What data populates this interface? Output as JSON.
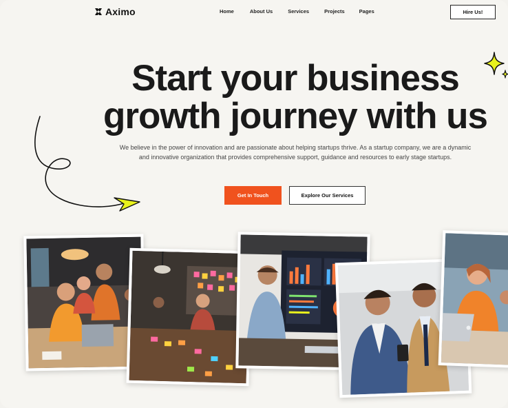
{
  "brand": {
    "name": "Aximo"
  },
  "nav": {
    "items": [
      "Home",
      "About Us",
      "Services",
      "Projects",
      "Pages"
    ]
  },
  "header": {
    "cta_label": "Hire Us!"
  },
  "hero": {
    "title_line1": "Start your business",
    "title_line2": "growth journey with us",
    "subtitle_line1": "We believe in the power of innovation and are passionate about helping startups thrive. As a startup company, we are a dynamic",
    "subtitle_line2": "and innovative organization that provides comprehensive support, guidance and resources to early stage startups.",
    "primary_cta": "Get In Touch",
    "secondary_cta": "Explore Our Services"
  },
  "colors": {
    "accent": "#f0521e",
    "highlight": "#e9f21d",
    "text": "#1a1a1a",
    "background": "#f6f5f1"
  },
  "icons": [
    "aximo-logo-icon",
    "sparkle-star-icon",
    "curly-arrow-icon"
  ],
  "gallery": {
    "photos": [
      "team-laptop-photo",
      "sticky-notes-planning-photo",
      "data-dashboard-photo",
      "two-men-phone-photo",
      "woman-laptop-photo"
    ]
  }
}
